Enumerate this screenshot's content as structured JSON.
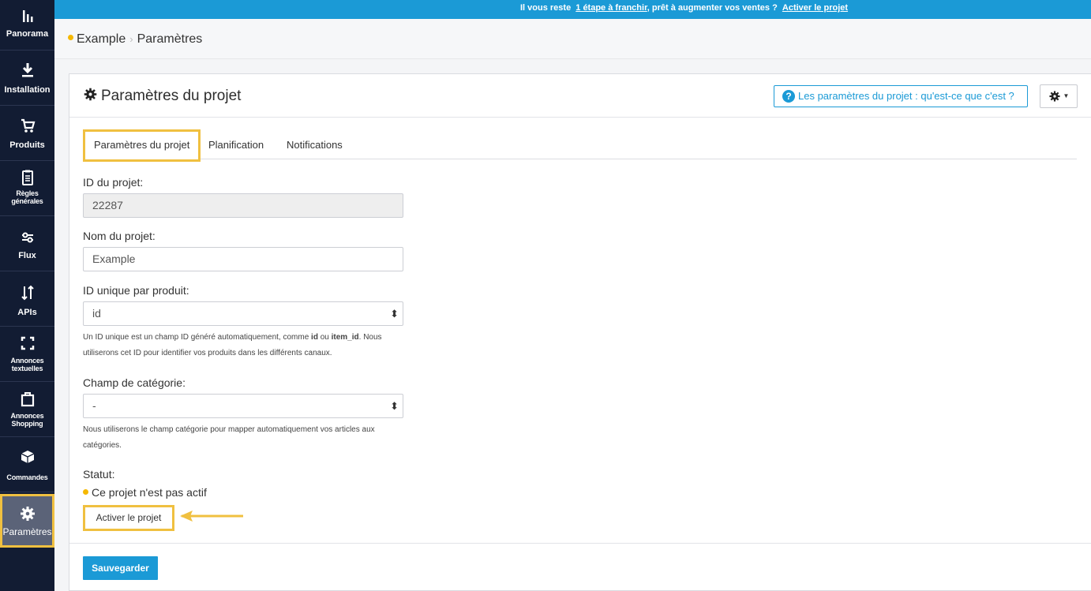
{
  "banner": {
    "text_before": "Il vous reste",
    "link_steps": "1 étape à franchir",
    "text_after": ", prêt à augmenter vos ventes ?",
    "link_activate": "Activer le projet"
  },
  "sidebar": {
    "items": [
      {
        "label": "Panorama",
        "icon": "bar-chart-icon"
      },
      {
        "label": "Installation",
        "icon": "download-icon"
      },
      {
        "label": "Produits",
        "icon": "cart-icon"
      },
      {
        "label": "Règles générales",
        "icon": "clipboard-icon"
      },
      {
        "label": "Flux",
        "icon": "sliders-icon"
      },
      {
        "label": "APIs",
        "icon": "sort-arrows-icon"
      },
      {
        "label": "Annonces textuelles",
        "icon": "frame-corners-icon"
      },
      {
        "label": "Annonces Shopping",
        "icon": "shopping-bag-icon"
      },
      {
        "label": "Commandes",
        "icon": "package-icon"
      },
      {
        "label": "Paramètres",
        "icon": "gear-icon"
      }
    ]
  },
  "breadcrumb": {
    "project": "Example",
    "current": "Paramètres"
  },
  "panel": {
    "title": "Paramètres du projet",
    "help_label": "Les paramètres du projet : qu'est-ce que c'est ?"
  },
  "tabs": [
    "Paramètres du projet",
    "Planification",
    "Notifications"
  ],
  "form": {
    "project_id": {
      "label": "ID du projet:",
      "value": "22287"
    },
    "project_name": {
      "label": "Nom du projet:",
      "value": "Example"
    },
    "unique_id": {
      "label": "ID unique par produit:",
      "value": "id",
      "hint_1": "Un ID unique est un champ ID généré automatiquement, comme",
      "hint_id": "id",
      "hint_or": "ou",
      "hint_item_id": "item_id",
      "hint_2": ". Nous utiliserons cet ID pour identifier vos produits dans les différents canaux."
    },
    "category_field": {
      "label": "Champ de catégorie:",
      "value": "-",
      "hint": "Nous utiliserons le champ catégorie pour mapper automatiquement vos articles aux catégories."
    },
    "status": {
      "label": "Statut:",
      "text": "Ce projet n'est pas actif",
      "activate_label": "Activer le projet"
    }
  },
  "save_label": "Sauvegarder",
  "colors": {
    "accent": "#1b9ad6",
    "sidebar": "#121c33",
    "highlight": "#f0c040",
    "status_dot": "#f5b800"
  }
}
